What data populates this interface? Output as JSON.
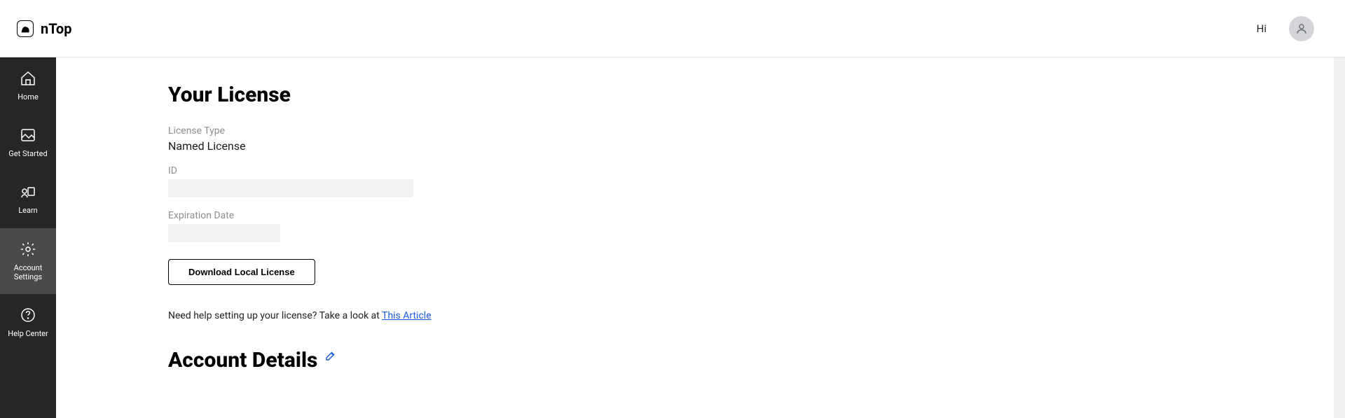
{
  "header": {
    "brand": "nTop",
    "greeting": "Hi"
  },
  "sidebar": {
    "items": [
      {
        "label": "Home"
      },
      {
        "label": "Get Started"
      },
      {
        "label": "Learn"
      },
      {
        "label": "Account Settings"
      },
      {
        "label": "Help Center"
      }
    ]
  },
  "license": {
    "title": "Your License",
    "type_label": "License Type",
    "type_value": "Named License",
    "id_label": "ID",
    "expiration_label": "Expiration Date",
    "download_button": "Download Local License",
    "help_text": "Need help setting up your license? Take a look at ",
    "help_link": "This Article"
  },
  "account": {
    "title": "Account Details"
  }
}
